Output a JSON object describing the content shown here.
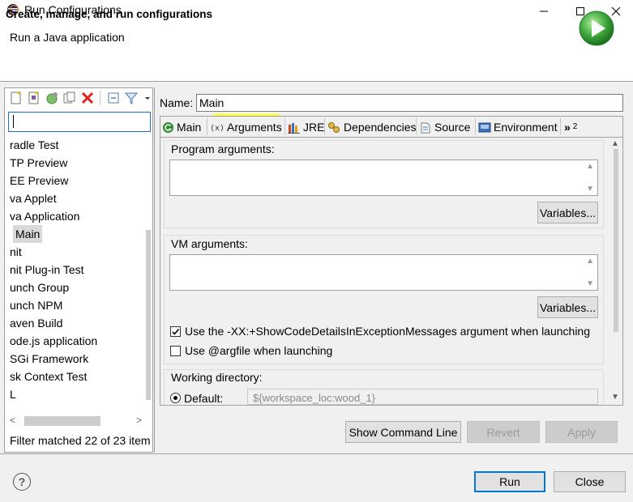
{
  "window": {
    "title": "Run Configurations"
  },
  "header": {
    "title": "Create, manage, and run configurations",
    "subtitle": "Run a Java application"
  },
  "left": {
    "filter_value": "",
    "items": [
      "radle Test",
      "TP Preview",
      "EE Preview",
      "va Applet",
      "va Application",
      "Main",
      "nit",
      "nit Plug-in Test",
      "unch Group",
      "unch NPM",
      "aven Build",
      "ode.js application",
      "SGi Framework",
      "sk Context Test",
      "L"
    ],
    "status": "Filter matched 22 of 23 item"
  },
  "right": {
    "name_label": "Name:",
    "name_value": "Main",
    "tabs": [
      {
        "label": "Main",
        "icon": "main-tab-icon"
      },
      {
        "label": "Arguments",
        "icon": "arguments-icon"
      },
      {
        "label": "JRE",
        "icon": "jre-icon"
      },
      {
        "label": "Dependencies",
        "icon": "dependencies-icon"
      },
      {
        "label": "Source",
        "icon": "source-icon"
      },
      {
        "label": "Environment",
        "icon": "environment-icon"
      }
    ],
    "overflow_label": "»",
    "overflow_count": "2",
    "program_args_label": "Program arguments:",
    "program_args_value": "",
    "variables_label": "Variables...",
    "vm_args_label": "VM arguments:",
    "vm_args_value": "",
    "checkbox_show_code": {
      "label": "Use the -XX:+ShowCodeDetailsInExceptionMessages argument when launching",
      "checked": true
    },
    "checkbox_argfile": {
      "label": "Use @argfile when launching",
      "checked": false
    },
    "working_dir_label": "Working directory:",
    "default_label": "Default:",
    "default_value": "${workspace_loc:wood_1}"
  },
  "actions": {
    "show_command_line": "Show Command Line",
    "revert": "Revert",
    "apply": "Apply",
    "run": "Run",
    "close": "Close"
  },
  "colors": {
    "highlight": "#ffff3a",
    "accent": "#0078d7",
    "run_green": "#3aa53a"
  }
}
